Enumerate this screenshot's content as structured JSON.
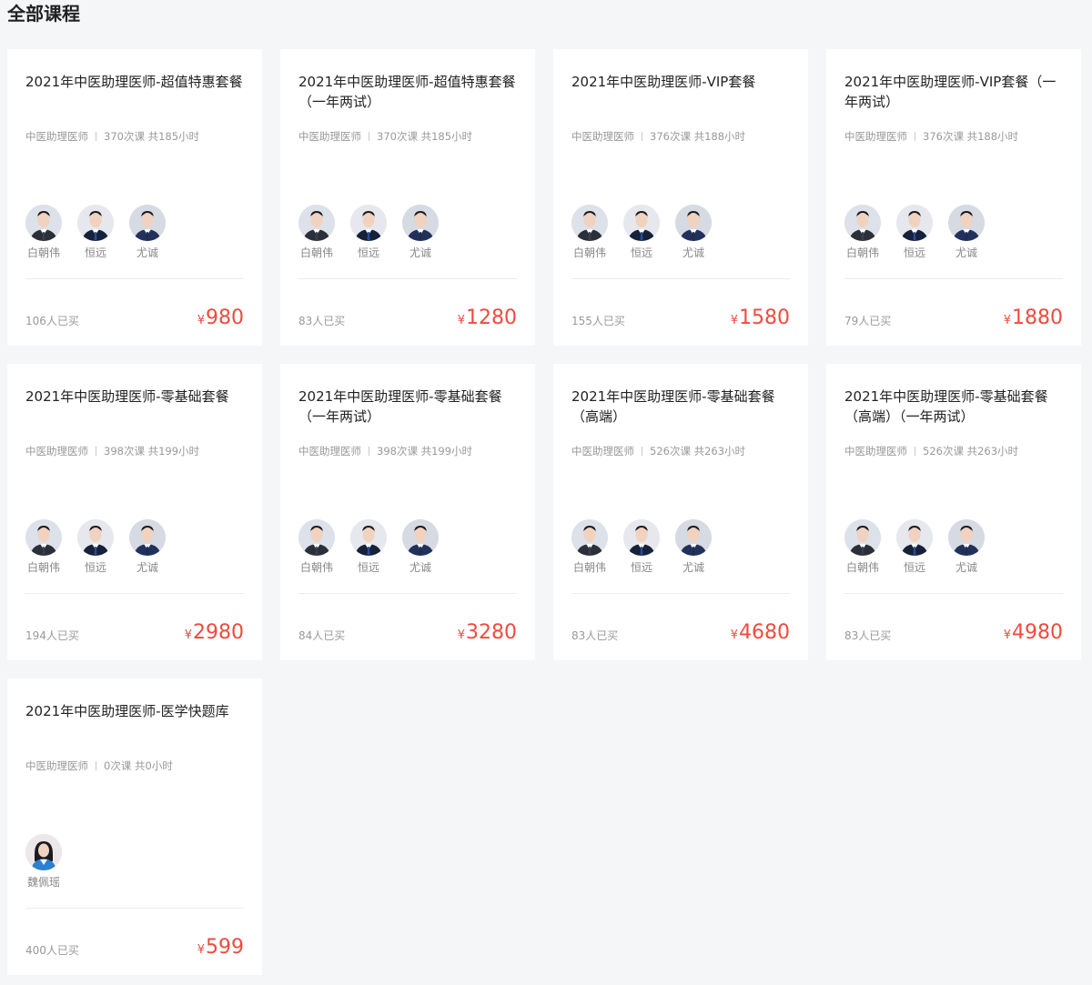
{
  "page": {
    "title": "全部课程"
  },
  "colors": {
    "background": "#f5f6f8",
    "card": "#ffffff",
    "price": "#f04a3e",
    "meta": "#999999"
  },
  "cards": [
    {
      "title": "2021年中医助理医师-超值特惠套餐",
      "category": "中医助理医师",
      "lessons": "370次课 共185小时",
      "teachers": [
        "白朝伟",
        "恒远",
        "尤诚"
      ],
      "sold": "106人已买",
      "currency": "¥",
      "price": "980"
    },
    {
      "title": "2021年中医助理医师-超值特惠套餐（一年两试）",
      "category": "中医助理医师",
      "lessons": "370次课 共185小时",
      "teachers": [
        "白朝伟",
        "恒远",
        "尤诚"
      ],
      "sold": "83人已买",
      "currency": "¥",
      "price": "1280"
    },
    {
      "title": "2021年中医助理医师-VIP套餐",
      "category": "中医助理医师",
      "lessons": "376次课 共188小时",
      "teachers": [
        "白朝伟",
        "恒远",
        "尤诚"
      ],
      "sold": "155人已买",
      "currency": "¥",
      "price": "1580"
    },
    {
      "title": "2021年中医助理医师-VIP套餐（一年两试）",
      "category": "中医助理医师",
      "lessons": "376次课 共188小时",
      "teachers": [
        "白朝伟",
        "恒远",
        "尤诚"
      ],
      "sold": "79人已买",
      "currency": "¥",
      "price": "1880"
    },
    {
      "title": "2021年中医助理医师-零基础套餐",
      "category": "中医助理医师",
      "lessons": "398次课 共199小时",
      "teachers": [
        "白朝伟",
        "恒远",
        "尤诚"
      ],
      "sold": "194人已买",
      "currency": "¥",
      "price": "2980"
    },
    {
      "title": "2021年中医助理医师-零基础套餐（一年两试）",
      "category": "中医助理医师",
      "lessons": "398次课 共199小时",
      "teachers": [
        "白朝伟",
        "恒远",
        "尤诚"
      ],
      "sold": "84人已买",
      "currency": "¥",
      "price": "3280"
    },
    {
      "title": "2021年中医助理医师-零基础套餐（高端）",
      "category": "中医助理医师",
      "lessons": "526次课 共263小时",
      "teachers": [
        "白朝伟",
        "恒远",
        "尤诚"
      ],
      "sold": "83人已买",
      "currency": "¥",
      "price": "4680"
    },
    {
      "title": "2021年中医助理医师-零基础套餐（高端）（一年两试）",
      "category": "中医助理医师",
      "lessons": "526次课 共263小时",
      "teachers": [
        "白朝伟",
        "恒远",
        "尤诚"
      ],
      "sold": "83人已买",
      "currency": "¥",
      "price": "4980"
    },
    {
      "title": "2021年中医助理医师-医学快题库",
      "category": "中医助理医师",
      "lessons": "0次课 共0小时",
      "teachers": [
        "魏佩瑶"
      ],
      "sold": "400人已买",
      "currency": "¥",
      "price": "599"
    }
  ]
}
